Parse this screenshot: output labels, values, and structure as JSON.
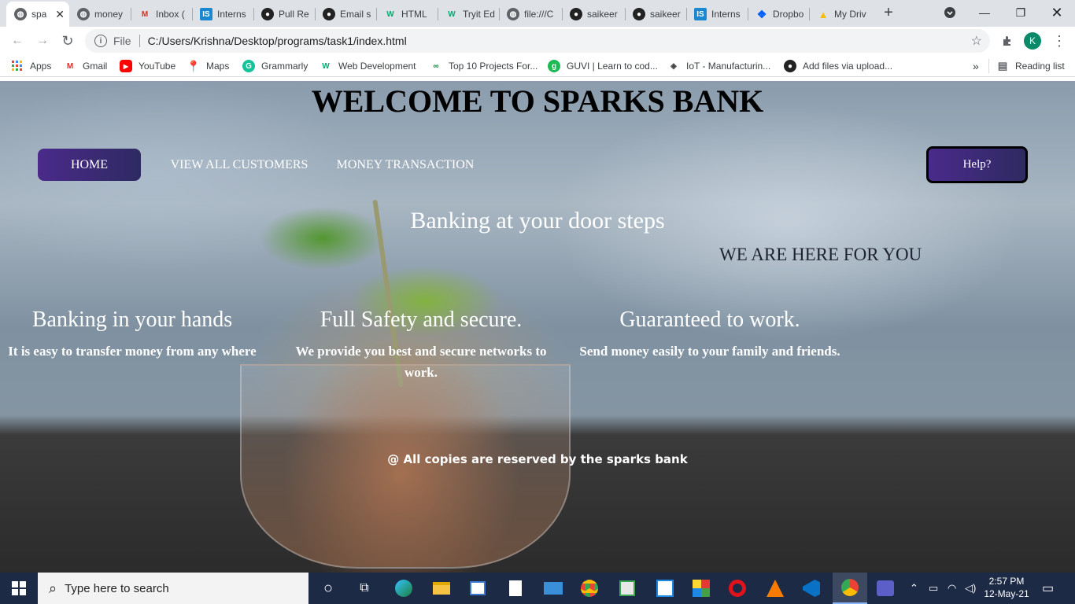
{
  "browser": {
    "tabs": [
      {
        "title": "spa",
        "icon": "globe-icon",
        "active": true
      },
      {
        "title": "money",
        "icon": "globe-icon"
      },
      {
        "title": "Inbox (",
        "icon": "gmail-icon"
      },
      {
        "title": "Interns",
        "icon": "internshala-icon"
      },
      {
        "title": "Pull Re",
        "icon": "github-icon"
      },
      {
        "title": "Email s",
        "icon": "github-icon"
      },
      {
        "title": "HTML",
        "icon": "w3schools-icon"
      },
      {
        "title": "Tryit Ed",
        "icon": "w3schools-icon"
      },
      {
        "title": "file:///C",
        "icon": "globe-icon"
      },
      {
        "title": "saikeer",
        "icon": "github-icon"
      },
      {
        "title": "saikeer",
        "icon": "github-icon"
      },
      {
        "title": "Interns",
        "icon": "internshala-icon"
      },
      {
        "title": "Dropbo",
        "icon": "dropbox-icon"
      },
      {
        "title": "My Driv",
        "icon": "google-drive-icon"
      }
    ],
    "new_tab_label": "+",
    "address": {
      "scheme_label": "File",
      "url": "C:/Users/Krishna/Desktop/programs/task1/index.html"
    },
    "profile_initial": "K",
    "bookmarks": [
      {
        "label": "Apps",
        "icon": "apps-grid-icon"
      },
      {
        "label": "Gmail",
        "icon": "gmail-icon"
      },
      {
        "label": "YouTube",
        "icon": "youtube-icon"
      },
      {
        "label": "Maps",
        "icon": "maps-pin-icon"
      },
      {
        "label": "Grammarly",
        "icon": "grammarly-icon"
      },
      {
        "label": "Web Development",
        "icon": "w3schools-icon"
      },
      {
        "label": "Top 10 Projects For...",
        "icon": "projects-icon"
      },
      {
        "label": "GUVI | Learn to cod...",
        "icon": "guvi-icon"
      },
      {
        "label": "IoT - Manufacturin...",
        "icon": "iot-icon"
      },
      {
        "label": "Add files via upload...",
        "icon": "github-icon"
      }
    ],
    "more_bookmarks": "»",
    "reading_list": "Reading list"
  },
  "site": {
    "title": "WELCOME TO SPARKS BANK",
    "nav": {
      "home": "HOME",
      "customers": "VIEW ALL CUSTOMERS",
      "transaction": "MONEY TRANSACTION",
      "help": "Help?"
    },
    "tagline": "Banking at your door steps",
    "subtagline": "WE ARE HERE FOR YOU",
    "features": [
      {
        "heading": "Banking in your hands",
        "text": "It is easy to transfer money from any where"
      },
      {
        "heading": "Full Safety and secure.",
        "text": "We provide you best and secure networks to work."
      },
      {
        "heading": "Guaranteed to work.",
        "text": "Send money easily to your family and friends."
      }
    ],
    "footer": "@ All copies are reserved by the sparks bank"
  },
  "taskbar": {
    "search_placeholder": "Type here to search",
    "time": "2:57 PM",
    "date": "12-May-21",
    "apps": [
      "cortana-icon",
      "task-view-icon",
      "edge-icon",
      "file-explorer-icon",
      "store-icon",
      "notepad-icon",
      "mail-icon",
      "chrome-icon",
      "app-icon",
      "app-icon",
      "office-icon",
      "opera-icon",
      "vlc-icon",
      "vscode-icon",
      "chrome-icon",
      "teams-icon"
    ]
  },
  "colors": {
    "nav_button": "#4a2a8a",
    "tab_strip": "#dee1e6",
    "taskbar": "#1c2a45"
  }
}
